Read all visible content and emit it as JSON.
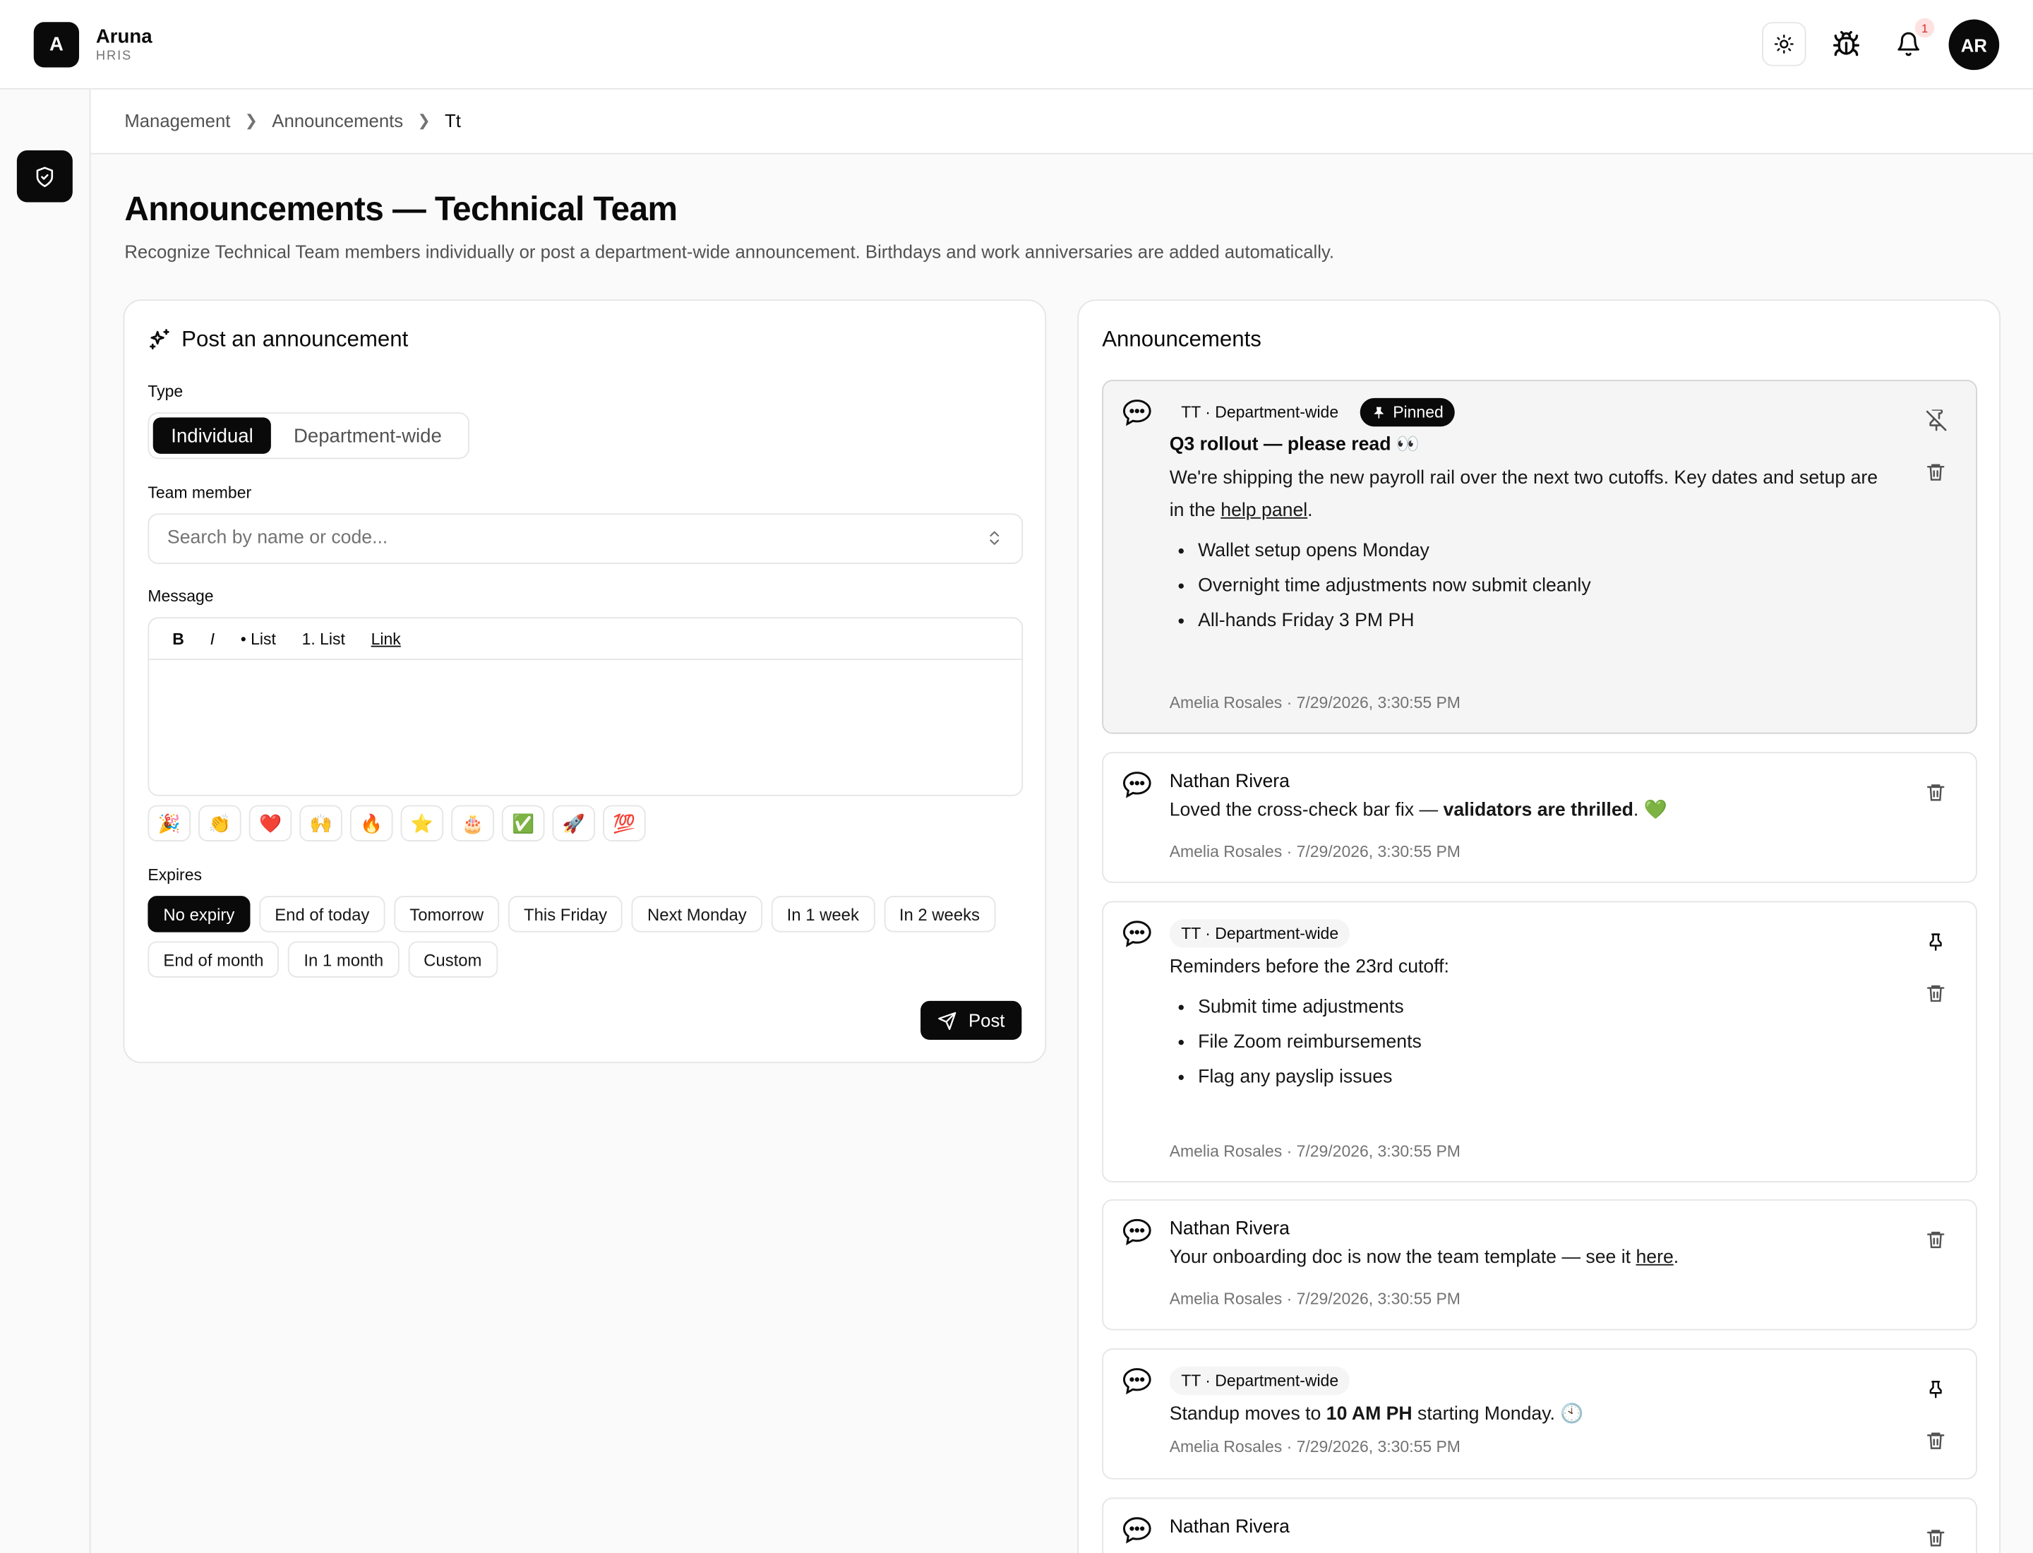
{
  "app": {
    "logo_letter": "A",
    "name": "Aruna",
    "subtitle": "HRIS",
    "notification_count": "1",
    "avatar_initials": "AR"
  },
  "breadcrumb": [
    "Management",
    "Announcements",
    "Tt"
  ],
  "page": {
    "title": "Announcements — Technical Team",
    "subtitle": "Recognize Technical Team members individually or post a department-wide announcement. Birthdays and work anniversaries are added automatically."
  },
  "form": {
    "heading": "Post an announcement",
    "type_label": "Type",
    "type_options": [
      "Individual",
      "Department-wide"
    ],
    "member_label": "Team member",
    "member_placeholder": "Search by name or code...",
    "message_label": "Message",
    "toolbar": [
      "B",
      "I",
      "• List",
      "1. List",
      "Link"
    ],
    "emojis": [
      "🎉",
      "👏",
      "❤️",
      "🙌",
      "🔥",
      "⭐",
      "🎂",
      "✅",
      "🚀",
      "💯"
    ],
    "expires_label": "Expires",
    "expires_options": [
      "No expiry",
      "End of today",
      "Tomorrow",
      "This Friday",
      "Next Monday",
      "In 1 week",
      "In 2 weeks",
      "End of month",
      "In 1 month",
      "Custom"
    ],
    "expires_selected": "No expiry",
    "post_label": "Post"
  },
  "feed": {
    "heading": "Announcements",
    "items": [
      {
        "tag": "TT · Department-wide",
        "pinned_label": "Pinned",
        "title": "Q3 rollout — please read 👀",
        "text_before": "We're shipping the new payroll rail over the next two cutoffs. Key dates and setup are in the ",
        "link": "help panel",
        "text_after": ".",
        "bullets": [
          "Wallet setup opens Monday",
          "Overnight time adjustments now submit cleanly",
          "All-hands Friday 3 PM PH"
        ],
        "meta": "Amelia Rosales · 7/29/2026, 3:30:55 PM"
      },
      {
        "author": "Nathan Rivera",
        "text_before": "Loved the cross-check bar fix — ",
        "bold": "validators are thrilled",
        "text_after": ". 💚",
        "meta": "Amelia Rosales · 7/29/2026, 3:30:55 PM"
      },
      {
        "tag": "TT · Department-wide",
        "text": "Reminders before the 23rd cutoff:",
        "bullets": [
          "Submit time adjustments",
          "File Zoom reimbursements",
          "Flag any payslip issues"
        ],
        "meta": "Amelia Rosales · 7/29/2026, 3:30:55 PM"
      },
      {
        "author": "Nathan Rivera",
        "text_before": "Your onboarding doc is now the team template — see it ",
        "link": "here",
        "text_after": ".",
        "meta": "Amelia Rosales · 7/29/2026, 3:30:55 PM"
      },
      {
        "tag": "TT · Department-wide",
        "text_before": "Standup moves to ",
        "bold": "10 AM PH",
        "text_after": " starting Monday. 🕙",
        "meta": "Amelia Rosales · 7/29/2026, 3:30:55 PM"
      },
      {
        "author": "Nathan Rivera"
      }
    ]
  }
}
